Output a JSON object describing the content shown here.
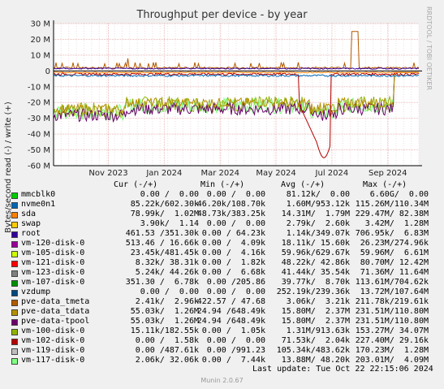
{
  "chart_data": {
    "type": "line",
    "title": "Throughput per device - by year",
    "ylabel": "Bytes/second read (-) / write (+)",
    "side_label": "RRDTOOL / TOBI OETIKER",
    "ylim": [
      -60,
      30
    ],
    "y_unit": "M",
    "y_ticks": [
      "30 M",
      "20 M",
      "10 M",
      "0",
      "-10 M",
      "-20 M",
      "-30 M",
      "-40 M",
      "-50 M",
      "-60 M"
    ],
    "y_tick_values": [
      30,
      20,
      10,
      0,
      -10,
      -20,
      -30,
      -40,
      -50,
      -60
    ],
    "x_ticks": [
      "Nov 2023",
      "Jan 2024",
      "Mar 2024",
      "May 2024",
      "Jul 2024",
      "Sep 2024"
    ],
    "grid": true,
    "legend_columns": [
      "Cur (-/+)",
      "Min (-/+)",
      "Avg (-/+)",
      "Max (-/+)"
    ],
    "series": [
      {
        "name": "mmcblk0",
        "color": "#00cc00",
        "cur": "0.00 /  0.00",
        "min": "0.00 /  0.00",
        "avg": "81.12k/  0.00",
        "max": "6.60G/  0.00"
      },
      {
        "name": "nvme0n1",
        "color": "#0066b3",
        "cur": "85.22k/602.30k",
        "min": "46.20k/108.70k",
        "avg": "1.60M/953.12k",
        "max": "115.26M/110.34M"
      },
      {
        "name": "sda",
        "color": "#ff8000",
        "cur": "78.99k/  1.02M",
        "min": "48.73k/383.25k",
        "avg": "14.31M/  1.79M",
        "max": "229.47M/ 82.38M"
      },
      {
        "name": "swap",
        "color": "#ffcc00",
        "cur": "3.90k/  1.14",
        "min": "0.00 /  0.00",
        "avg": "2.79k/  2.60k",
        "max": "3.42M/  1.28M"
      },
      {
        "name": "root",
        "color": "#330099",
        "cur": "461.53 /351.30k",
        "min": "0.00 / 64.23k",
        "avg": "1.14k/349.07k",
        "max": "706.95k/  6.83M"
      },
      {
        "name": "vm-120-disk-0",
        "color": "#990099",
        "cur": "513.46 / 16.66k",
        "min": "0.00 /  4.09k",
        "avg": "18.11k/ 15.60k",
        "max": "26.23M/274.96k"
      },
      {
        "name": "vm-105-disk-0",
        "color": "#ccff00",
        "cur": "23.45k/481.45k",
        "min": "0.00 /  4.16k",
        "avg": "59.96k/629.67k",
        "max": "59.96M/  6.61M"
      },
      {
        "name": "vm-121-disk-0",
        "color": "#ff0000",
        "cur": "8.32k/ 38.31k",
        "min": "0.00 /  1.82k",
        "avg": "48.22k/ 42.86k",
        "max": "80.70M/ 12.42M"
      },
      {
        "name": "vm-123-disk-0",
        "color": "#808080",
        "cur": "5.24k/ 44.26k",
        "min": "0.00 /  6.68k",
        "avg": "41.44k/ 35.54k",
        "max": "71.36M/ 11.64M"
      },
      {
        "name": "vm-107-disk-0",
        "color": "#008f00",
        "cur": "351.30 /  6.78k",
        "min": "0.00 /205.86",
        "avg": "39.77k/  8.70k",
        "max": "113.61M/704.62k"
      },
      {
        "name": "vzdump",
        "color": "#00487d",
        "cur": "0.00 /  0.00",
        "min": "0.00 /  0.00",
        "avg": "252.19k/239.36k",
        "max": "13.72M/107.64M"
      },
      {
        "name": "pve-data_tmeta",
        "color": "#b35a00",
        "cur": "2.41k/  2.96k",
        "min": "422.57 / 47.68",
        "avg": "3.06k/  3.21k",
        "max": "211.78k/219.61k"
      },
      {
        "name": "pve-data_tdata",
        "color": "#b38f00",
        "cur": "55.03k/  1.26M",
        "min": "24.94 /648.49k",
        "avg": "15.80M/  2.37M",
        "max": "231.51M/110.80M"
      },
      {
        "name": "pve-data-tpool",
        "color": "#6b006b",
        "cur": "55.03k/  1.26M",
        "min": "24.94 /648.49k",
        "avg": "15.80M/  2.37M",
        "max": "231.51M/110.80M"
      },
      {
        "name": "vm-100-disk-0",
        "color": "#8fb300",
        "cur": "15.11k/182.55k",
        "min": "0.00 /  1.05k",
        "avg": "1.31M/913.63k",
        "max": "153.27M/ 34.07M"
      },
      {
        "name": "vm-102-disk-0",
        "color": "#b30000",
        "cur": "0.00 /  1.58k",
        "min": "0.00 /  0.00",
        "avg": "71.53k/  2.04k",
        "max": "227.40M/ 29.16k"
      },
      {
        "name": "vm-119-disk-0",
        "color": "#bebebe",
        "cur": "0.00 /487.61k",
        "min": "0.00 /991.23",
        "avg": "105.34k/483.62k",
        "max": "170.23M/  1.28M"
      },
      {
        "name": "vm-117-disk-0",
        "color": "#80ff80",
        "cur": "2.06k/ 32.06k",
        "min": "0.00 /  7.44k",
        "avg": "13.88M/ 48.20k",
        "max": "203.01M/  4.09M"
      }
    ]
  },
  "footer": {
    "last_update": "Last update: Tue Oct 22 22:15:06 2024",
    "munin": "Munin 2.0.67"
  }
}
